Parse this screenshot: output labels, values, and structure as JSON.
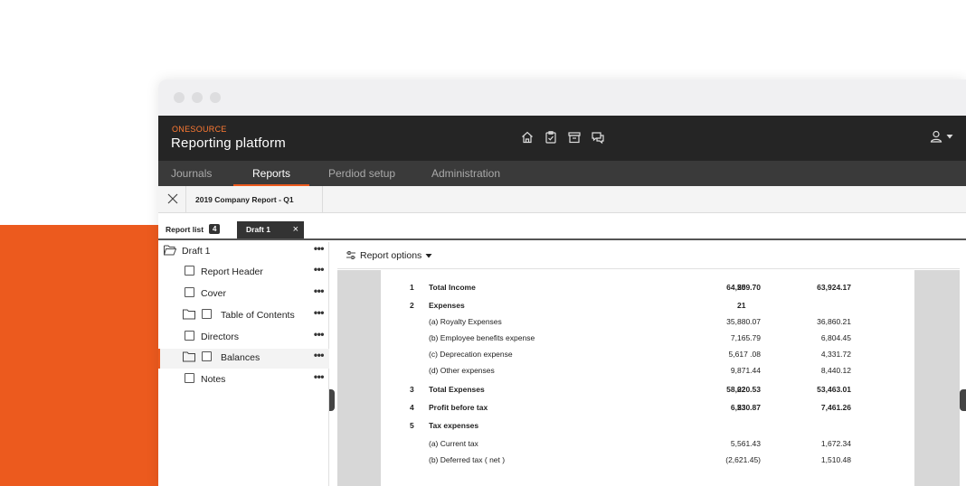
{
  "app": {
    "brand_small": "ONESOURCE",
    "brand_title": "Reporting platform",
    "accent_color": "#ec5a1e",
    "top_icons": [
      "home-icon",
      "clipboard-check-icon",
      "archive-icon",
      "chat-icon"
    ],
    "user_icon": "user-icon"
  },
  "nav": {
    "items": [
      {
        "label": "Journals"
      },
      {
        "label": "Reports",
        "active": true
      },
      {
        "label": "Perdiod setup"
      },
      {
        "label": "Administration"
      }
    ]
  },
  "doc_tabs": {
    "active_label": "2019 Company Report - Q1"
  },
  "view_tabs": {
    "report_list_label": "Report list",
    "report_list_count": "4",
    "draft_label": "Draft 1",
    "close_glyph": "×"
  },
  "sidebar": {
    "root_label": "Draft 1",
    "more_glyph": "•••",
    "items": [
      {
        "label": "Report Header"
      },
      {
        "label": "Cover"
      },
      {
        "label": "Table of Contents",
        "folder": true
      },
      {
        "label": "Directors"
      },
      {
        "label": "Balances",
        "folder": true,
        "selected": true
      },
      {
        "label": "Notes"
      }
    ]
  },
  "main": {
    "options_label": "Report options"
  },
  "report": {
    "rows": [
      {
        "num": "1",
        "desc": "Total Income",
        "note": "20",
        "current": "64,559.70",
        "previous": "63,924.17",
        "bold": true
      },
      {
        "num": "2",
        "desc": "Expenses",
        "note": "21",
        "current": "",
        "previous": "",
        "bold": true
      },
      {
        "num": "",
        "desc": "(a) Royalty Expenses",
        "note": "",
        "current": "35,880.07",
        "previous": "36,860.21",
        "bold": false
      },
      {
        "num": "",
        "desc": "(b) Employee benefits expense",
        "note": "",
        "current": "7,165.79",
        "previous": "6,804.45",
        "bold": false
      },
      {
        "num": "",
        "desc": "(c) Deprecation expense",
        "note": "",
        "current": "5,617 .08",
        "previous": "4,331.72",
        "bold": false
      },
      {
        "num": "",
        "desc": "(d) Other expenses",
        "note": "",
        "current": "9,871.44",
        "previous": "8,440.12",
        "bold": false
      },
      {
        "num": "3",
        "desc": "Total Expenses",
        "note": "22",
        "current": "58,020.53",
        "previous": "53,463.01",
        "bold": true
      },
      {
        "num": "4",
        "desc": "Profit before tax",
        "note": "23",
        "current": "6,530.87",
        "previous": "7,461.26",
        "bold": true
      },
      {
        "num": "5",
        "desc": "Tax expenses",
        "note": "",
        "current": "",
        "previous": "",
        "bold": true
      },
      {
        "num": "",
        "desc": "(a) Current tax",
        "note": "",
        "current": "5,561.43",
        "previous": "1,672.34",
        "bold": false
      },
      {
        "num": "",
        "desc": "(b) Deferred tax ( net )",
        "note": "",
        "current": "(2,621.45)",
        "previous": "1,510.48",
        "bold": false
      }
    ]
  }
}
